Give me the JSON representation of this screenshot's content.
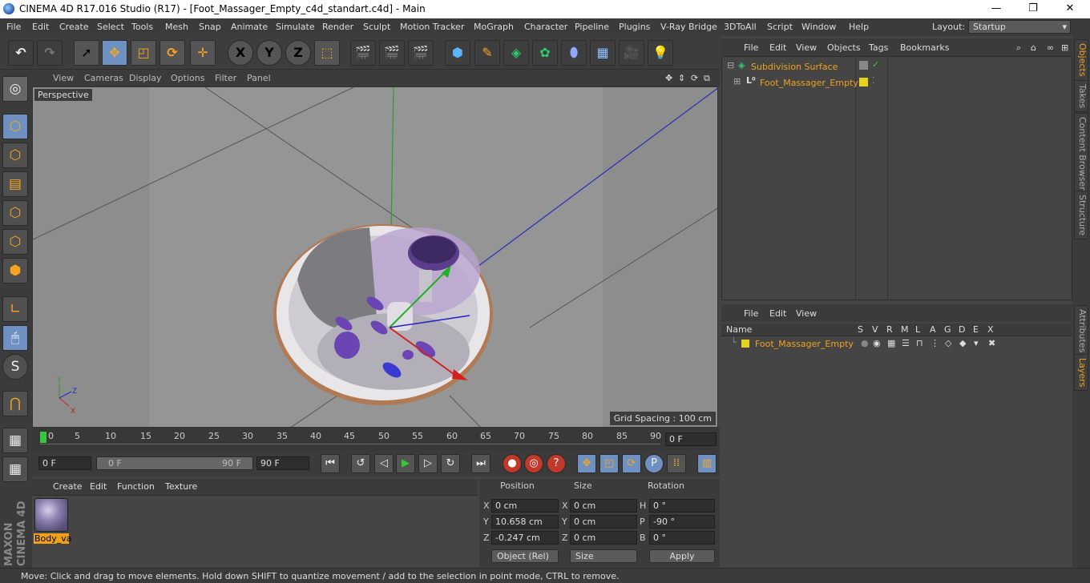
{
  "title_bar": {
    "title": "CINEMA 4D R17.016 Studio (R17) - [Foot_Massager_Empty_c4d_standart.c4d] - Main",
    "minimize": "—",
    "maximize": "❐",
    "close": "✕"
  },
  "menubar": {
    "items": [
      "File",
      "Edit",
      "Create",
      "Select",
      "Tools",
      "Mesh",
      "Snap",
      "Animate",
      "Simulate",
      "Render",
      "Sculpt",
      "Motion Tracker",
      "MoGraph",
      "Character",
      "Pipeline",
      "Plugins",
      "V-Ray Bridge",
      "3DToAll",
      "Script",
      "Window",
      "Help"
    ],
    "layout_label": "Layout:",
    "layout_value": "Startup"
  },
  "toolbar": {
    "axis_x": "X",
    "axis_y": "Y",
    "axis_z": "Z",
    "icons": [
      "undo-icon",
      "redo-icon",
      "live-selection-icon",
      "move-icon",
      "scale-icon",
      "rotate-icon",
      "recent-tool-icon",
      "x-axis-icon",
      "y-axis-icon",
      "z-axis-icon",
      "coordinate-system-icon",
      "render-view-icon",
      "render-picture-viewer-icon",
      "edit-render-settings-icon",
      "cube-icon",
      "pen-icon",
      "subdivision-icon",
      "cloner-icon",
      "deformer-icon",
      "floor-icon",
      "camera-icon",
      "light-icon"
    ]
  },
  "viewport": {
    "menu": [
      "View",
      "Cameras",
      "Display",
      "Options",
      "Filter",
      "Panel"
    ],
    "label": "Perspective",
    "grid_spacing": "Grid Spacing : 100 cm",
    "axis_labels": {
      "x": "X",
      "y": "Y",
      "z": "Z"
    }
  },
  "timeline": {
    "ticks": [
      "0",
      "5",
      "10",
      "15",
      "20",
      "25",
      "30",
      "35",
      "40",
      "45",
      "50",
      "55",
      "60",
      "65",
      "70",
      "75",
      "80",
      "85",
      "90"
    ],
    "current_frame": "0 F",
    "start_field": "0 F",
    "range_min": "0 F",
    "range_max": "90 F",
    "end_field": "90 F"
  },
  "material_manager": {
    "menu": [
      "Create",
      "Edit",
      "Function",
      "Texture"
    ],
    "materials": [
      {
        "name": "Body_va"
      }
    ]
  },
  "coordinates": {
    "headers": {
      "position": "Position",
      "size": "Size",
      "rotation": "Rotation"
    },
    "rows": [
      {
        "axis": "X",
        "position": "0 cm",
        "size_axis": "X",
        "size": "0 cm",
        "rot_axis": "H",
        "rotation": "0 °"
      },
      {
        "axis": "Y",
        "position": "10.658 cm",
        "size_axis": "Y",
        "size": "0 cm",
        "rot_axis": "P",
        "rotation": "-90 °"
      },
      {
        "axis": "Z",
        "position": "-0.247 cm",
        "size_axis": "Z",
        "size": "0 cm",
        "rot_axis": "B",
        "rotation": "0 °"
      }
    ],
    "mode": "Object (Rel)",
    "size_mode": "Size",
    "apply": "Apply"
  },
  "status_bar": {
    "text": "Move: Click and drag to move elements. Hold down SHIFT to quantize movement / add to the selection in point mode, CTRL to remove."
  },
  "object_manager": {
    "menu": [
      "File",
      "Edit",
      "View",
      "Objects",
      "Tags",
      "Bookmarks"
    ],
    "objects": [
      {
        "name": "Subdivision Surface",
        "level": 0
      },
      {
        "name": "Foot_Massager_Empty",
        "level": 1
      }
    ]
  },
  "layer_manager": {
    "menu": [
      "File",
      "Edit",
      "View"
    ],
    "columns": [
      "Name",
      "S",
      "V",
      "R",
      "M",
      "L",
      "A",
      "G",
      "D",
      "E",
      "X"
    ],
    "layers": [
      {
        "name": "Foot_Massager_Empty",
        "color": "#e6d21e"
      }
    ]
  },
  "right_tabs": [
    "Objects",
    "Takes",
    "Content Browser",
    "Structure",
    "Attributes",
    "Layers"
  ],
  "colors": {
    "accent": "#6f91c2",
    "highlight": "#f0a11b",
    "layer": "#e6d21e"
  }
}
